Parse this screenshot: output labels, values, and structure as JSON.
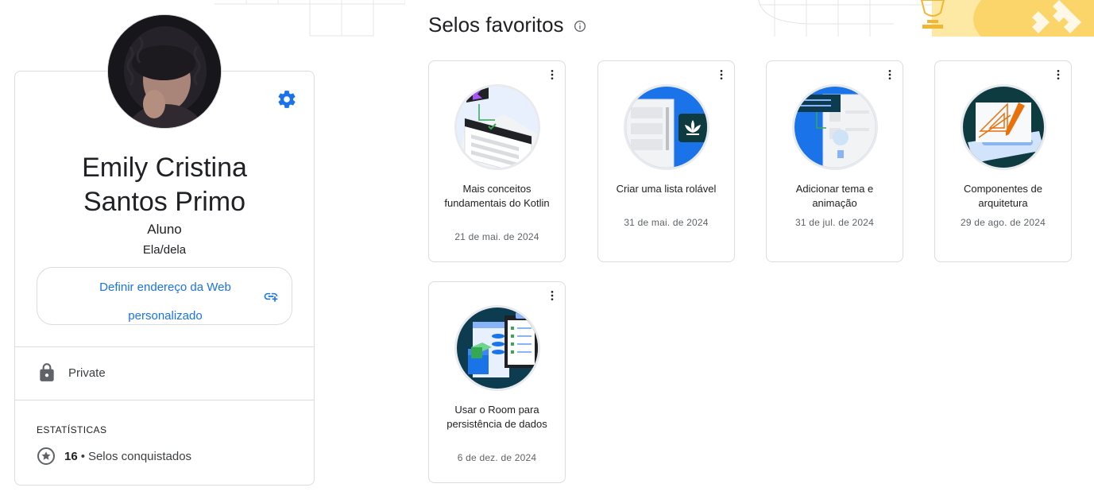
{
  "profile": {
    "name_line1": "Emily Cristina",
    "name_line2": "Santos Primo",
    "role": "Aluno",
    "pronouns": "Ela/dela",
    "custom_url_line1": "Definir endereço da Web",
    "custom_url_line2": "personalizado",
    "privacy": "Private",
    "stats_title": "ESTATÍSTICAS",
    "badges_count": "16",
    "badges_separator": "•",
    "badges_label": "Selos conquistados"
  },
  "favorites": {
    "title": "Selos favoritos",
    "badges": [
      {
        "title": "Mais conceitos fundamentais do Kotlin",
        "date": "21 de mai. de 2024"
      },
      {
        "title": "Criar uma lista rolável",
        "date": "31 de mai. de 2024"
      },
      {
        "title": "Adicionar tema e animação",
        "date": "31 de jul. de 2024"
      },
      {
        "title": "Componentes de arquitetura",
        "date": "29 de ago. de 2024"
      },
      {
        "title": "Usar o Room para persistência de dados",
        "date": "6 de dez. de 2024"
      }
    ]
  },
  "colors": {
    "accent": "#1a73e8",
    "border": "#dadce0",
    "text_primary": "#202124",
    "text_secondary": "#5f6368"
  },
  "icons": {
    "settings": "gear-icon",
    "link": "add-link-icon",
    "privacy": "lock-icon",
    "stats": "star-circle-icon",
    "info": "info-icon",
    "menu": "more-vert-icon"
  }
}
